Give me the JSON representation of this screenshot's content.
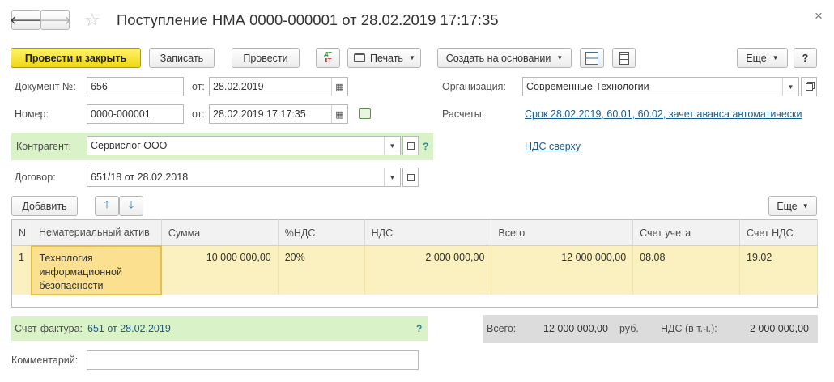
{
  "header": {
    "title": "Поступление НМА 0000-000001 от 28.02.2019 17:17:35",
    "close_glyph": "×"
  },
  "toolbar": {
    "post_close": "Провести и закрыть",
    "save": "Записать",
    "post": "Провести",
    "dtkt": "ДТ КТ",
    "print": "Печать",
    "create_based": "Создать на основании",
    "more": "Еще",
    "help": "?"
  },
  "form": {
    "doc_no_label": "Документ №:",
    "doc_no_value": "656",
    "doc_from_label": "от:",
    "doc_date": "28.02.2019",
    "number_label": "Номер:",
    "number_value": "0000-000001",
    "number_from_label": "от:",
    "number_datetime": "28.02.2019 17:17:35",
    "org_label": "Организация:",
    "org_value": "Современные Технологии",
    "settlements_label": "Расчеты:",
    "settlements_link": "Срок 28.02.2019, 60.01, 60.02, зачет аванса автоматически",
    "vat_link": "НДС сверху",
    "counterparty_label": "Контрагент:",
    "counterparty_value": "Сервислог ООО",
    "contract_label": "Договор:",
    "contract_value": "651/18 от 28.02.2018",
    "help": "?"
  },
  "table_toolbar": {
    "add": "Добавить",
    "more": "Еще"
  },
  "table": {
    "columns": [
      "N",
      "Нематериальный актив",
      "Сумма",
      "%НДС",
      "НДС",
      "Всего",
      "Счет учета",
      "Счет НДС"
    ],
    "rows": [
      {
        "n": "1",
        "asset": "Технология информационной безопасности",
        "sum": "10 000 000,00",
        "vat_rate": "20%",
        "vat": "2 000 000,00",
        "total": "12 000 000,00",
        "account": "08.08",
        "vat_account": "19.02"
      }
    ]
  },
  "footer": {
    "invoice_label": "Счет-фактура:",
    "invoice_link": "651 от 28.02.2019",
    "help": "?",
    "total_label": "Всего:",
    "total_value": "12 000 000,00",
    "currency": "руб.",
    "vat_label": "НДС (в т.ч.):",
    "vat_value": "2 000 000,00",
    "comment_label": "Комментарий:",
    "comment_value": ""
  },
  "colors": {
    "primary_button": "#f0d613",
    "green_band": "#d9f2c7",
    "row_highlight": "#fbf1c0",
    "link": "#1d5d8a"
  }
}
